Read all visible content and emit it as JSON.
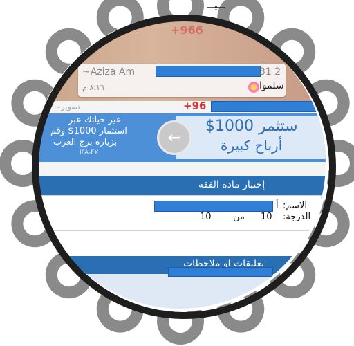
{
  "top_text": "ــيــ",
  "chat": {
    "number_top": "+966",
    "sender": "~Aziza Am",
    "sender_suffix": "31 2",
    "time": "٨:١٦ م",
    "message_end": "سلموا"
  },
  "ad": {
    "number": "+96",
    "prefix": "~تصوير",
    "left_line1": "غير حياتك عبر",
    "left_line2": "استثمار 1000$ وقم",
    "left_line3": "بزيارة برج العرب",
    "left_brand": "IFA-FX",
    "right_line1": "ستثمر 1000$",
    "right_line2": "أرباح كبيرة"
  },
  "quiz": {
    "title": "إختبار مادة الفقة",
    "name_label": "الاسم:",
    "name_value": "أ",
    "grade_label": "الدرجة:",
    "grade_value": "10",
    "grade_of": "من",
    "grade_total": "10"
  },
  "notes": {
    "title": "تعليقات او ملاحظات"
  },
  "colors": {
    "ring": "#1e1e1e",
    "header_blue": "#2b6fb3",
    "redaction": "#2f7fd6",
    "number_red": "#d23b3b"
  }
}
